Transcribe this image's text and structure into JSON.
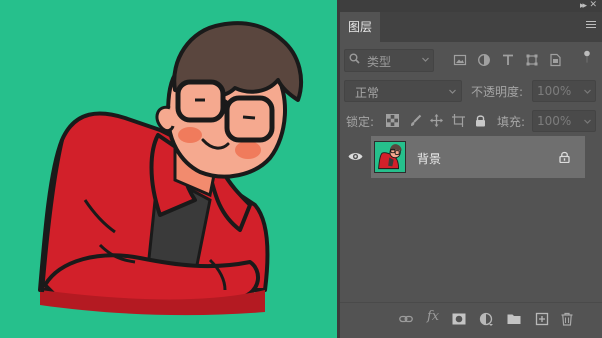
{
  "canvas": {
    "background_color": "#26c08c",
    "artwork": "cartoon-man-with-glasses-red-jacket"
  },
  "panel": {
    "tab_label": "图层",
    "collapse_icon": "double-chevron-right-icon",
    "close_icon": "close-icon",
    "menu_icon": "hamburger-menu-icon"
  },
  "filter": {
    "label": "类型",
    "icons": [
      "image-filter-icon",
      "adjustment-filter-icon",
      "type-filter-icon",
      "shape-filter-icon",
      "smart-object-filter-icon",
      "filter-toggle-icon"
    ]
  },
  "blend": {
    "mode": "正常",
    "opacity_label": "不透明度:",
    "opacity_value": "100%"
  },
  "lock": {
    "label": "锁定:",
    "icons": [
      "lock-transparent-pixels-icon",
      "lock-image-pixels-icon",
      "lock-position-icon",
      "lock-artboard-icon",
      "lock-all-icon"
    ],
    "fill_label": "填充:",
    "fill_value": "100%"
  },
  "layers": [
    {
      "name": "背景",
      "visible": true,
      "locked": true,
      "selected": true
    }
  ],
  "bottom_bar": {
    "fx_label": "fx",
    "icons": [
      "link-layers-icon",
      "layer-style-icon",
      "add-mask-icon",
      "new-adjustment-layer-icon",
      "new-group-icon",
      "new-layer-icon",
      "delete-layer-icon"
    ]
  },
  "colors": {
    "panel_bg": "#535353",
    "selected_layer_bg": "#6f6f6f",
    "canvas_green": "#26c08c",
    "jacket_red": "#d2202a"
  }
}
